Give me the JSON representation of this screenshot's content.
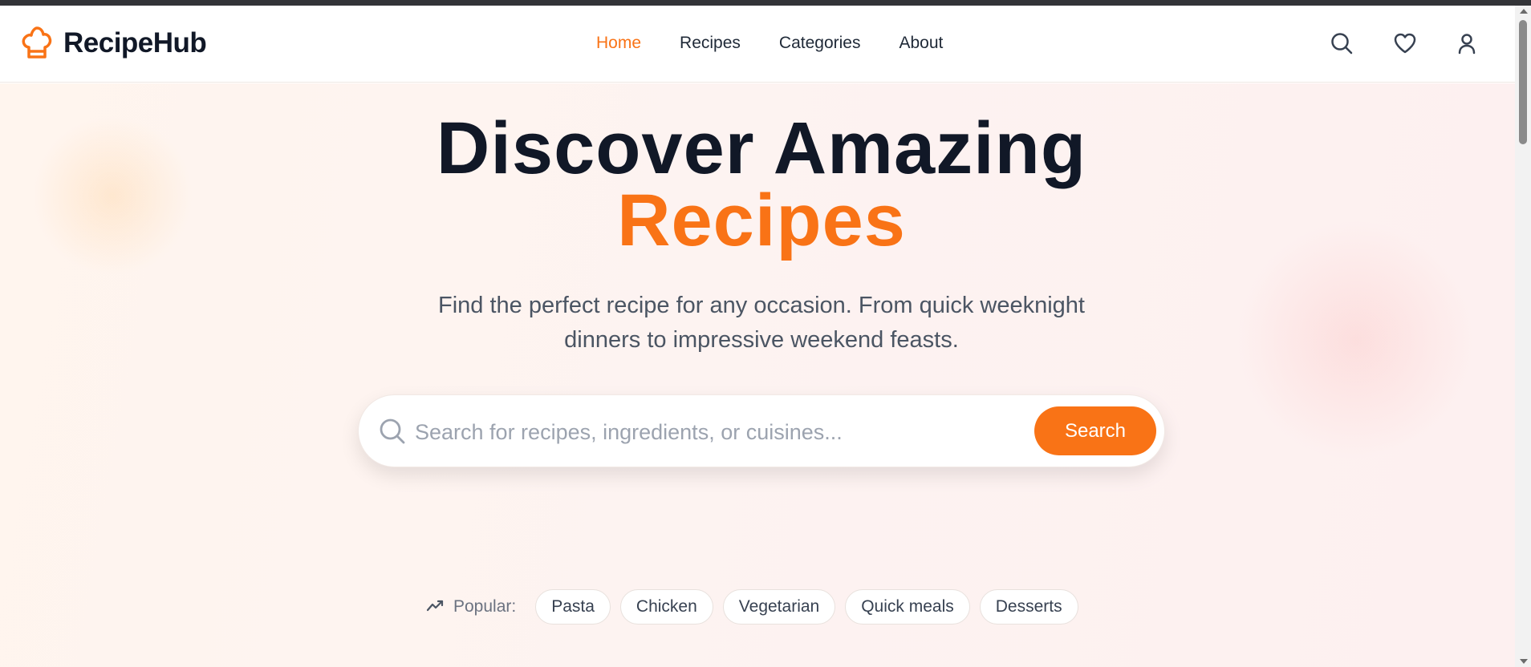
{
  "brand": {
    "name": "RecipeHub",
    "accent_color": "#f97316",
    "icon": "chef-hat-icon"
  },
  "nav": {
    "items": [
      {
        "label": "Home",
        "active": true
      },
      {
        "label": "Recipes",
        "active": false
      },
      {
        "label": "Categories",
        "active": false
      },
      {
        "label": "About",
        "active": false
      }
    ]
  },
  "header_icons": [
    "search-icon",
    "heart-icon",
    "user-icon"
  ],
  "hero": {
    "title_line1": "Discover Amazing",
    "title_line2": "Recipes",
    "subtitle_line1": "Find the perfect recipe for any occasion. From quick weeknight",
    "subtitle_line2": "dinners to impressive weekend feasts."
  },
  "search": {
    "placeholder": "Search for recipes, ingredients, or cuisines...",
    "value": "",
    "button_label": "Search"
  },
  "popular": {
    "label": "Popular:",
    "icon": "trending-up-icon",
    "tags": [
      "Pasta",
      "Chicken",
      "Vegetarian",
      "Quick meals",
      "Desserts"
    ]
  }
}
